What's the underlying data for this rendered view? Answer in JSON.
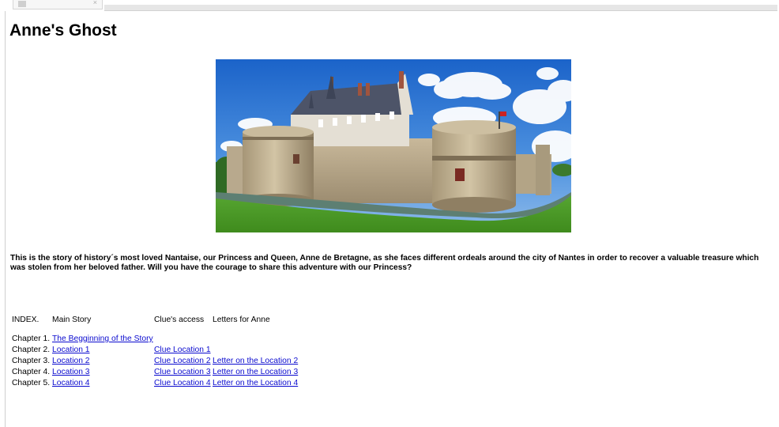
{
  "page": {
    "title": "Anne's Ghost",
    "intro": "This is the story of history´s most loved Nantaise, our Princess and Queen, Anne de Bretagne, as she faces different ordeals around the city of Nantes in order to recover a valuable treasure which was stolen from her beloved father. Will you have the courage to share this adventure with our Princess?"
  },
  "hero_image": {
    "subject": "castle of the Dukes of Brittany in Nantes"
  },
  "index": {
    "headers": [
      "INDEX.",
      "Main Story",
      "Clue's access",
      "Letters for Anne"
    ],
    "rows": [
      {
        "chapter": "Chapter 1.",
        "main": "The Begginning of the Story",
        "clue": "",
        "letter": ""
      },
      {
        "chapter": "Chapter 2.",
        "main": "Location 1",
        "clue": "Clue Location 1",
        "letter": ""
      },
      {
        "chapter": "Chapter 3.",
        "main": "Location 2",
        "clue": "Clue Location 2",
        "letter": "Letter on the Location 2"
      },
      {
        "chapter": "Chapter 4.",
        "main": "Location 3",
        "clue": "Clue Location 3",
        "letter": "Letter on the Location 3"
      },
      {
        "chapter": "Chapter 5.",
        "main": "Location 4",
        "clue": "Clue Location 4",
        "letter": "Letter on the Location 4"
      }
    ]
  },
  "colors": {
    "link": "#0b0bcf",
    "text": "#000000",
    "background": "#ffffff"
  }
}
